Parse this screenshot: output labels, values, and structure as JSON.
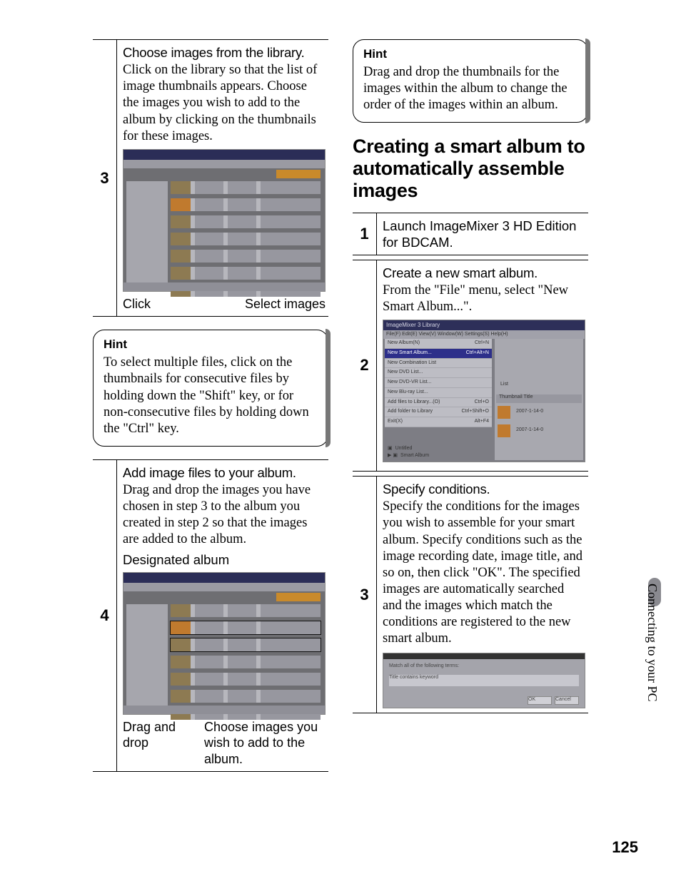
{
  "left": {
    "step3": {
      "num": "3",
      "lead": "Choose images from the library.",
      "text": "Click on the library so that the list of image thumbnails appears. Choose the images you wish to add to the album by clicking on the thumbnails for these images.",
      "caption_left": "Click",
      "caption_right": "Select images"
    },
    "hint": {
      "title": "Hint",
      "text": "To select multiple files, click on the thumbnails for consecutive files by holding down the \"Shift\" key, or for non-consecutive files by holding down the \"Ctrl\" key."
    },
    "step4": {
      "num": "4",
      "lead": "Add image files to your album.",
      "text": "Drag and drop the images you have chosen in step 3 to the album you created in step 2 so that the images are added to the album.",
      "sub_lead": "Designated album",
      "caption_left": "Drag and drop",
      "caption_right": "Choose images you wish to add to the album."
    }
  },
  "right": {
    "hint": {
      "title": "Hint",
      "text": "Drag and drop the thumbnails for the images within the album to change the order of the images within an album."
    },
    "section_title": "Creating a smart album to automatically assemble images",
    "step1": {
      "num": "1",
      "text": "Launch ImageMixer 3 HD Edition for BDCAM."
    },
    "step2": {
      "num": "2",
      "lead": "Create a new smart album.",
      "text": "From the \"File\" menu, select \"New Smart Album...\".",
      "menu": {
        "titlebar": "ImageMixer 3 Library",
        "menubar": "File(F)  Edit(E)  View(V)  Window(W)  Settings(S)  Help(H)",
        "items": [
          {
            "l": "New Album(N)",
            "r": "Ctrl+N"
          },
          {
            "l": "New Smart Album...",
            "r": "Ctrl+Alt+N"
          },
          {
            "l": "New Combination List",
            "r": ""
          },
          {
            "l": "New DVD List...",
            "r": ""
          },
          {
            "l": "New DVD-VR List...",
            "r": ""
          },
          {
            "l": "New Blu-ray List...",
            "r": ""
          },
          {
            "l": "Add files to Library...(O)",
            "r": "Ctrl+O"
          },
          {
            "l": "Add folder to Library",
            "r": "Ctrl+Shift+O"
          },
          {
            "l": "Exit(X)",
            "r": "Alt+F4"
          }
        ],
        "right_list_label": "List",
        "right_cols": "Thumbnail    Title",
        "right_date1": "2007-1-14-0",
        "right_date2": "2007-1-14-0",
        "bottom_items": [
          "Untitled",
          "Smart Album"
        ]
      }
    },
    "step3": {
      "num": "3",
      "lead": "Specify conditions.",
      "text": "Specify the conditions for the images you wish to assemble for your smart album. Specify conditions such as the image recording date, image title, and so on, then click \"OK\". The specified images are automatically searched and the images which match the conditions are registered to the new smart album.",
      "cond_label": "Match all of the following terms:",
      "cond_row": "Title        contains        keyword",
      "btn_ok": "OK",
      "btn_cancel": "Cancel"
    }
  },
  "side_tab": "Connecting to your PC",
  "page_number": "125"
}
